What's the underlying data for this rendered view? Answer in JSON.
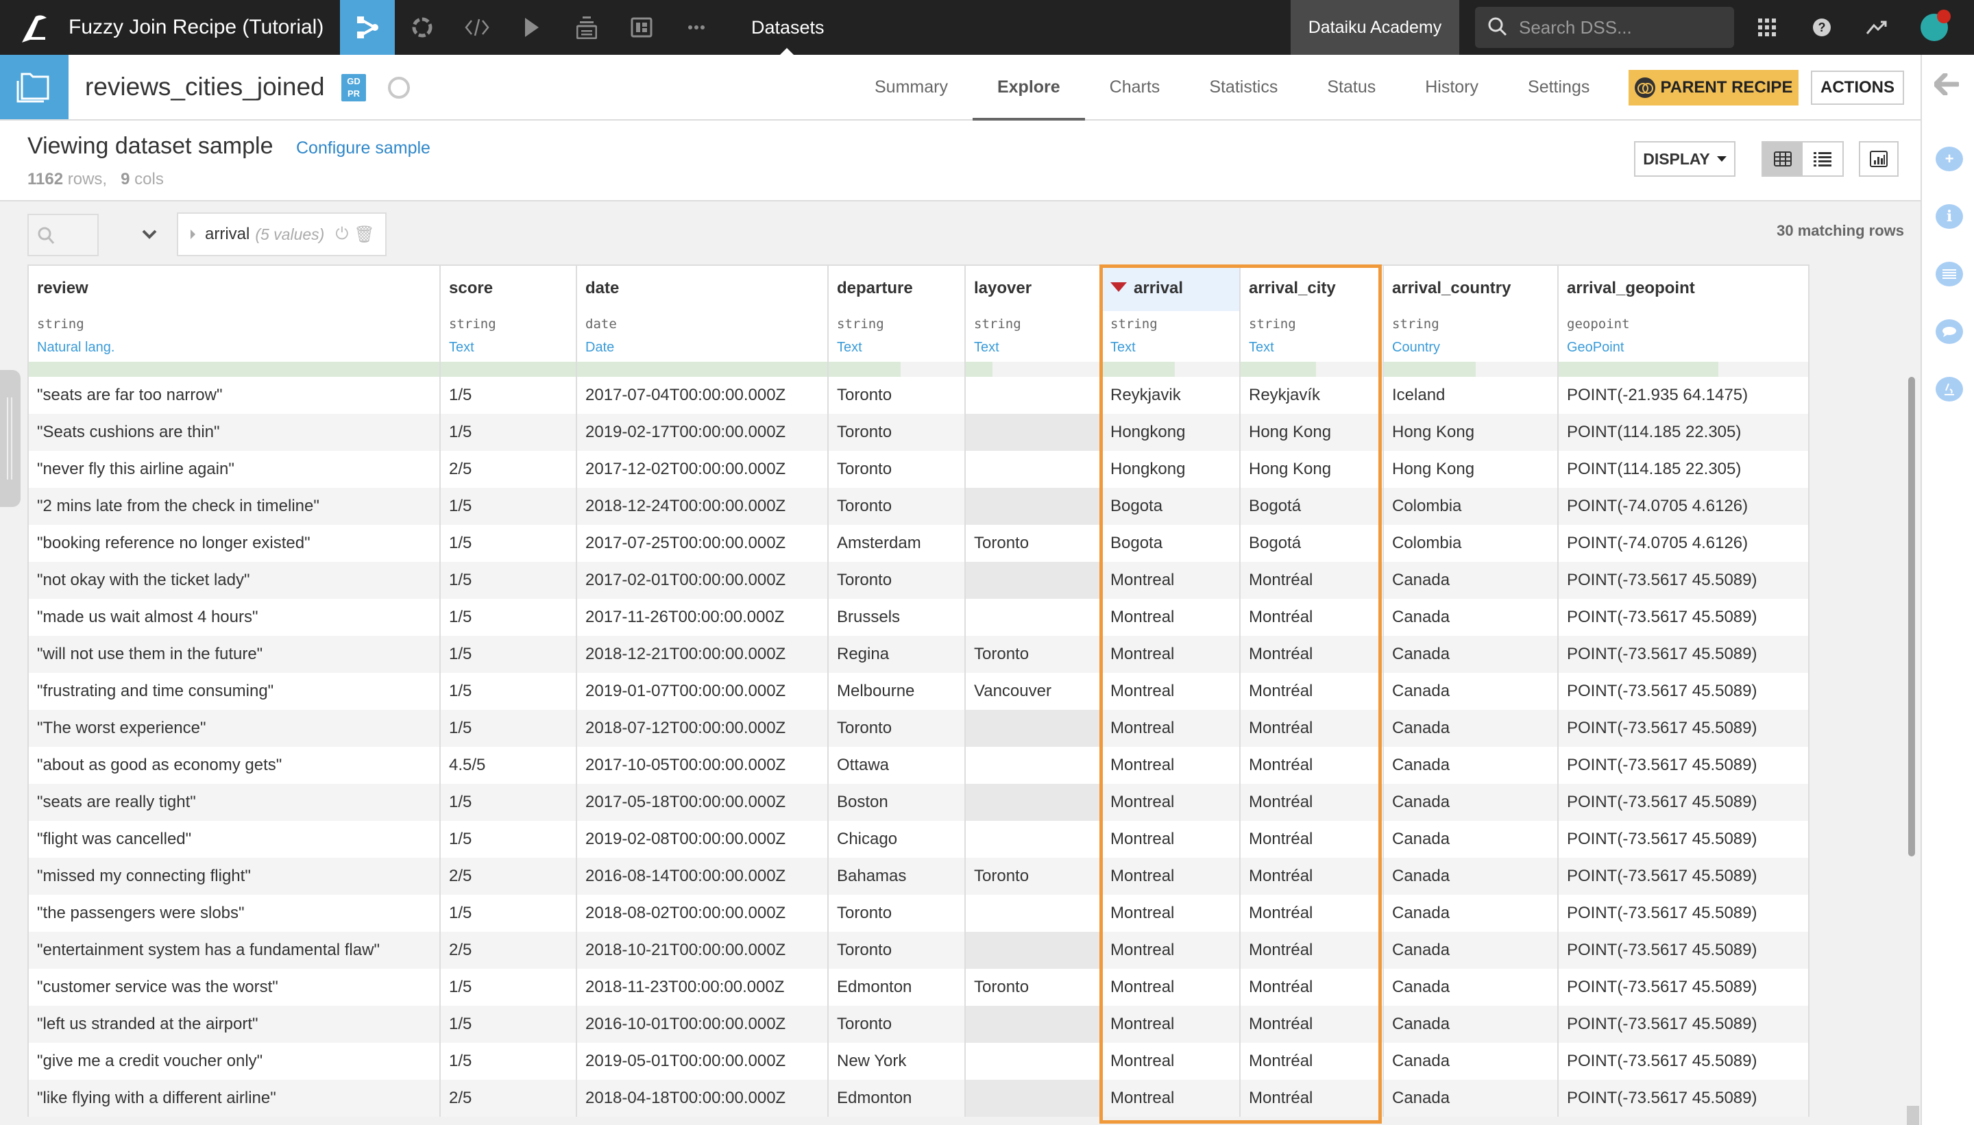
{
  "topbar": {
    "project_title": "Fuzzy Join Recipe (Tutorial)",
    "nav_icons": [
      "flow-icon",
      "lab-icon",
      "code-icon",
      "run-icon",
      "deploy-icon",
      "dashboard-icon",
      "more-icon"
    ],
    "current_section": "Datasets",
    "academy_label": "Dataiku Academy",
    "search_placeholder": "Search DSS...",
    "right_icons": [
      "apps-grid-icon",
      "help-icon",
      "activity-icon"
    ]
  },
  "dataset": {
    "name": "reviews_cities_joined",
    "badge": "GDPR",
    "badge_top": "GD",
    "badge_bottom": "PR",
    "tabs": [
      {
        "label": "Summary",
        "active": false
      },
      {
        "label": "Explore",
        "active": true
      },
      {
        "label": "Charts",
        "active": false
      },
      {
        "label": "Statistics",
        "active": false
      },
      {
        "label": "Status",
        "active": false
      },
      {
        "label": "History",
        "active": false
      },
      {
        "label": "Settings",
        "active": false
      }
    ],
    "parent_recipe_label": "PARENT RECIPE",
    "actions_label": "ACTIONS"
  },
  "colors": {
    "accent_blue": "#4ea5da",
    "parent_recipe_yellow": "#f2bf55",
    "highlight_orange": "#f0993a",
    "filter_red": "#c0282e",
    "meaning_blue": "#3a9bd8"
  },
  "view": {
    "title": "Viewing dataset sample",
    "configure_link": "Configure sample",
    "rows_count": "1162",
    "rows_label": "rows,",
    "cols_count": "9",
    "cols_label": "cols",
    "display_label": "DISPLAY",
    "matching_rows": "30 matching rows"
  },
  "filter": {
    "column": "arrival",
    "values_count": "(5 values)"
  },
  "columns": [
    {
      "name": "review",
      "storage": "string",
      "meaning": "Natural lang.",
      "valid_fraction": 1.0
    },
    {
      "name": "score",
      "storage": "string",
      "meaning": "Text",
      "valid_fraction": 1.0
    },
    {
      "name": "date",
      "storage": "date",
      "meaning": "Date",
      "valid_fraction": 1.0
    },
    {
      "name": "departure",
      "storage": "string",
      "meaning": "Text",
      "valid_fraction": 0.53
    },
    {
      "name": "layover",
      "storage": "string",
      "meaning": "Text",
      "valid_fraction": 0.2
    },
    {
      "name": "arrival",
      "storage": "string",
      "meaning": "Text",
      "valid_fraction": 0.53,
      "filtered": true
    },
    {
      "name": "arrival_city",
      "storage": "string",
      "meaning": "Text",
      "valid_fraction": 0.53
    },
    {
      "name": "arrival_country",
      "storage": "string",
      "meaning": "Country",
      "valid_fraction": 0.53
    },
    {
      "name": "arrival_geopoint",
      "storage": "geopoint",
      "meaning": "GeoPoint",
      "valid_fraction": 0.64
    }
  ],
  "rows": [
    [
      "\"seats are far too narrow\"",
      "1/5",
      "2017-07-04T00:00:00.000Z",
      "Toronto",
      "",
      "Reykjavik",
      "Reykjavík",
      "Iceland",
      "POINT(-21.935 64.1475)"
    ],
    [
      "\"Seats cushions are thin\"",
      "1/5",
      "2019-02-17T00:00:00.000Z",
      "Toronto",
      "",
      "Hongkong",
      "Hong Kong",
      "Hong Kong",
      "POINT(114.185 22.305)"
    ],
    [
      "\"never fly this airline again\"",
      "2/5",
      "2017-12-02T00:00:00.000Z",
      "Toronto",
      "",
      "Hongkong",
      "Hong Kong",
      "Hong Kong",
      "POINT(114.185 22.305)"
    ],
    [
      "\"2 mins late from the check in timeline\"",
      "1/5",
      "2018-12-24T00:00:00.000Z",
      "Toronto",
      "",
      "Bogota",
      "Bogotá",
      "Colombia",
      "POINT(-74.0705 4.6126)"
    ],
    [
      "\"booking reference no longer existed\"",
      "1/5",
      "2017-07-25T00:00:00.000Z",
      "Amsterdam",
      "Toronto",
      "Bogota",
      "Bogotá",
      "Colombia",
      "POINT(-74.0705 4.6126)"
    ],
    [
      "\"not okay with the ticket lady\"",
      "1/5",
      "2017-02-01T00:00:00.000Z",
      "Toronto",
      "",
      "Montreal",
      "Montréal",
      "Canada",
      "POINT(-73.5617 45.5089)"
    ],
    [
      "\"made us wait almost 4 hours\"",
      "1/5",
      "2017-11-26T00:00:00.000Z",
      "Brussels",
      "",
      "Montreal",
      "Montréal",
      "Canada",
      "POINT(-73.5617 45.5089)"
    ],
    [
      "\"will not use them in the future\"",
      "1/5",
      "2018-12-21T00:00:00.000Z",
      "Regina",
      "Toronto",
      "Montreal",
      "Montréal",
      "Canada",
      "POINT(-73.5617 45.5089)"
    ],
    [
      "\"frustrating and time consuming\"",
      "1/5",
      "2019-01-07T00:00:00.000Z",
      "Melbourne",
      "Vancouver",
      "Montreal",
      "Montréal",
      "Canada",
      "POINT(-73.5617 45.5089)"
    ],
    [
      "\"The worst experience\"",
      "1/5",
      "2018-07-12T00:00:00.000Z",
      "Toronto",
      "",
      "Montreal",
      "Montréal",
      "Canada",
      "POINT(-73.5617 45.5089)"
    ],
    [
      "\"about as good as economy gets\"",
      "4.5/5",
      "2017-10-05T00:00:00.000Z",
      "Ottawa",
      "",
      "Montreal",
      "Montréal",
      "Canada",
      "POINT(-73.5617 45.5089)"
    ],
    [
      "\"seats are really tight\"",
      "1/5",
      "2017-05-18T00:00:00.000Z",
      "Boston",
      "",
      "Montreal",
      "Montréal",
      "Canada",
      "POINT(-73.5617 45.5089)"
    ],
    [
      "\"flight was cancelled\"",
      "1/5",
      "2019-02-08T00:00:00.000Z",
      "Chicago",
      "",
      "Montreal",
      "Montréal",
      "Canada",
      "POINT(-73.5617 45.5089)"
    ],
    [
      "\"missed my connecting flight\"",
      "2/5",
      "2016-08-14T00:00:00.000Z",
      "Bahamas",
      "Toronto",
      "Montreal",
      "Montréal",
      "Canada",
      "POINT(-73.5617 45.5089)"
    ],
    [
      "\"the passengers were slobs\"",
      "1/5",
      "2018-08-02T00:00:00.000Z",
      "Toronto",
      "",
      "Montreal",
      "Montréal",
      "Canada",
      "POINT(-73.5617 45.5089)"
    ],
    [
      "\"entertainment system has a fundamental flaw\"",
      "2/5",
      "2018-10-21T00:00:00.000Z",
      "Toronto",
      "",
      "Montreal",
      "Montréal",
      "Canada",
      "POINT(-73.5617 45.5089)"
    ],
    [
      "\"customer service was the worst\"",
      "1/5",
      "2018-11-23T00:00:00.000Z",
      "Edmonton",
      "Toronto",
      "Montreal",
      "Montréal",
      "Canada",
      "POINT(-73.5617 45.5089)"
    ],
    [
      "\"left us stranded at the airport\"",
      "1/5",
      "2016-10-01T00:00:00.000Z",
      "Toronto",
      "",
      "Montreal",
      "Montréal",
      "Canada",
      "POINT(-73.5617 45.5089)"
    ],
    [
      "\"give me a credit voucher only\"",
      "1/5",
      "2019-05-01T00:00:00.000Z",
      "New York",
      "",
      "Montreal",
      "Montréal",
      "Canada",
      "POINT(-73.5617 45.5089)"
    ],
    [
      "\"like flying with a different airline\"",
      "2/5",
      "2018-04-18T00:00:00.000Z",
      "Edmonton",
      "",
      "Montreal",
      "Montréal",
      "Canada",
      "POINT(-73.5617 45.5089)"
    ]
  ],
  "right_sidebar": {
    "icons": [
      "back-arrow-icon",
      "add-icon",
      "info-icon",
      "schema-icon",
      "discussion-icon",
      "lab-icon"
    ]
  }
}
